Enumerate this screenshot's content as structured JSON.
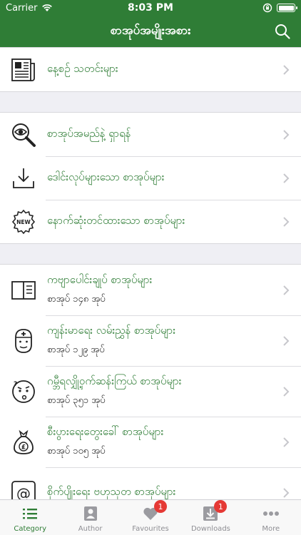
{
  "status_bar": {
    "carrier": "Carrier",
    "time": "8:03 PM",
    "battery_level": 1.0
  },
  "nav": {
    "title": "စာအုပ်အမျိုးအစား",
    "search_icon": "search-icon"
  },
  "sections": [
    {
      "rows": [
        {
          "icon": "newspaper-icon",
          "title": "နေ့စဉ် သတင်းများ"
        }
      ]
    },
    {
      "rows": [
        {
          "icon": "magnifier-eye-icon",
          "title": "စာအုပ်အမည်နဲ့ ရှာရန်"
        },
        {
          "icon": "download-icon",
          "title": "ဒေါင်းလုပ်များသော စာအုပ်များ"
        },
        {
          "icon": "new-badge-icon",
          "title": "နောက်ဆုံးတင်ထားသော စာအုပ်များ"
        }
      ]
    },
    {
      "rows": [
        {
          "icon": "open-book-icon",
          "title": "ကဗျာပေါင်းချုပ် စာအုပ်များ",
          "subtitle": "စာအုပ် ၁၄၈ အုပ်"
        },
        {
          "icon": "doctor-icon",
          "title": "ကျန်းမာရေး လမ်းညွှန် စာအုပ်များ",
          "subtitle": "စာအုပ် ၁၂၉ အုပ်"
        },
        {
          "icon": "thinking-face-icon",
          "title": "ဂမ္ဘီရလျှို့ဝှက်ဆန်းကြယ် စာအုပ်များ",
          "subtitle": "စာအုပ် ၃၅၁ အုပ်"
        },
        {
          "icon": "money-bag-icon",
          "title": "စီးပွားရေးတွေးခေါ် စာအုပ်များ",
          "subtitle": "စာအုပ် ၁၀၅ အုပ်"
        },
        {
          "icon": "at-sign-icon",
          "title": "စိုက်ပျိုးရေး ဗဟုသုတ စာအုပ်များ"
        }
      ]
    }
  ],
  "tabs": [
    {
      "label": "Category",
      "icon": "list-icon",
      "active": true
    },
    {
      "label": "Author",
      "icon": "author-icon"
    },
    {
      "label": "Favourites",
      "icon": "heart-icon",
      "badge": "1"
    },
    {
      "label": "Downloads",
      "icon": "download-tray-icon",
      "badge": "1"
    },
    {
      "label": "More",
      "icon": "more-icon"
    }
  ],
  "colors": {
    "brand": "#2f7d36",
    "badge": "#e53935"
  }
}
